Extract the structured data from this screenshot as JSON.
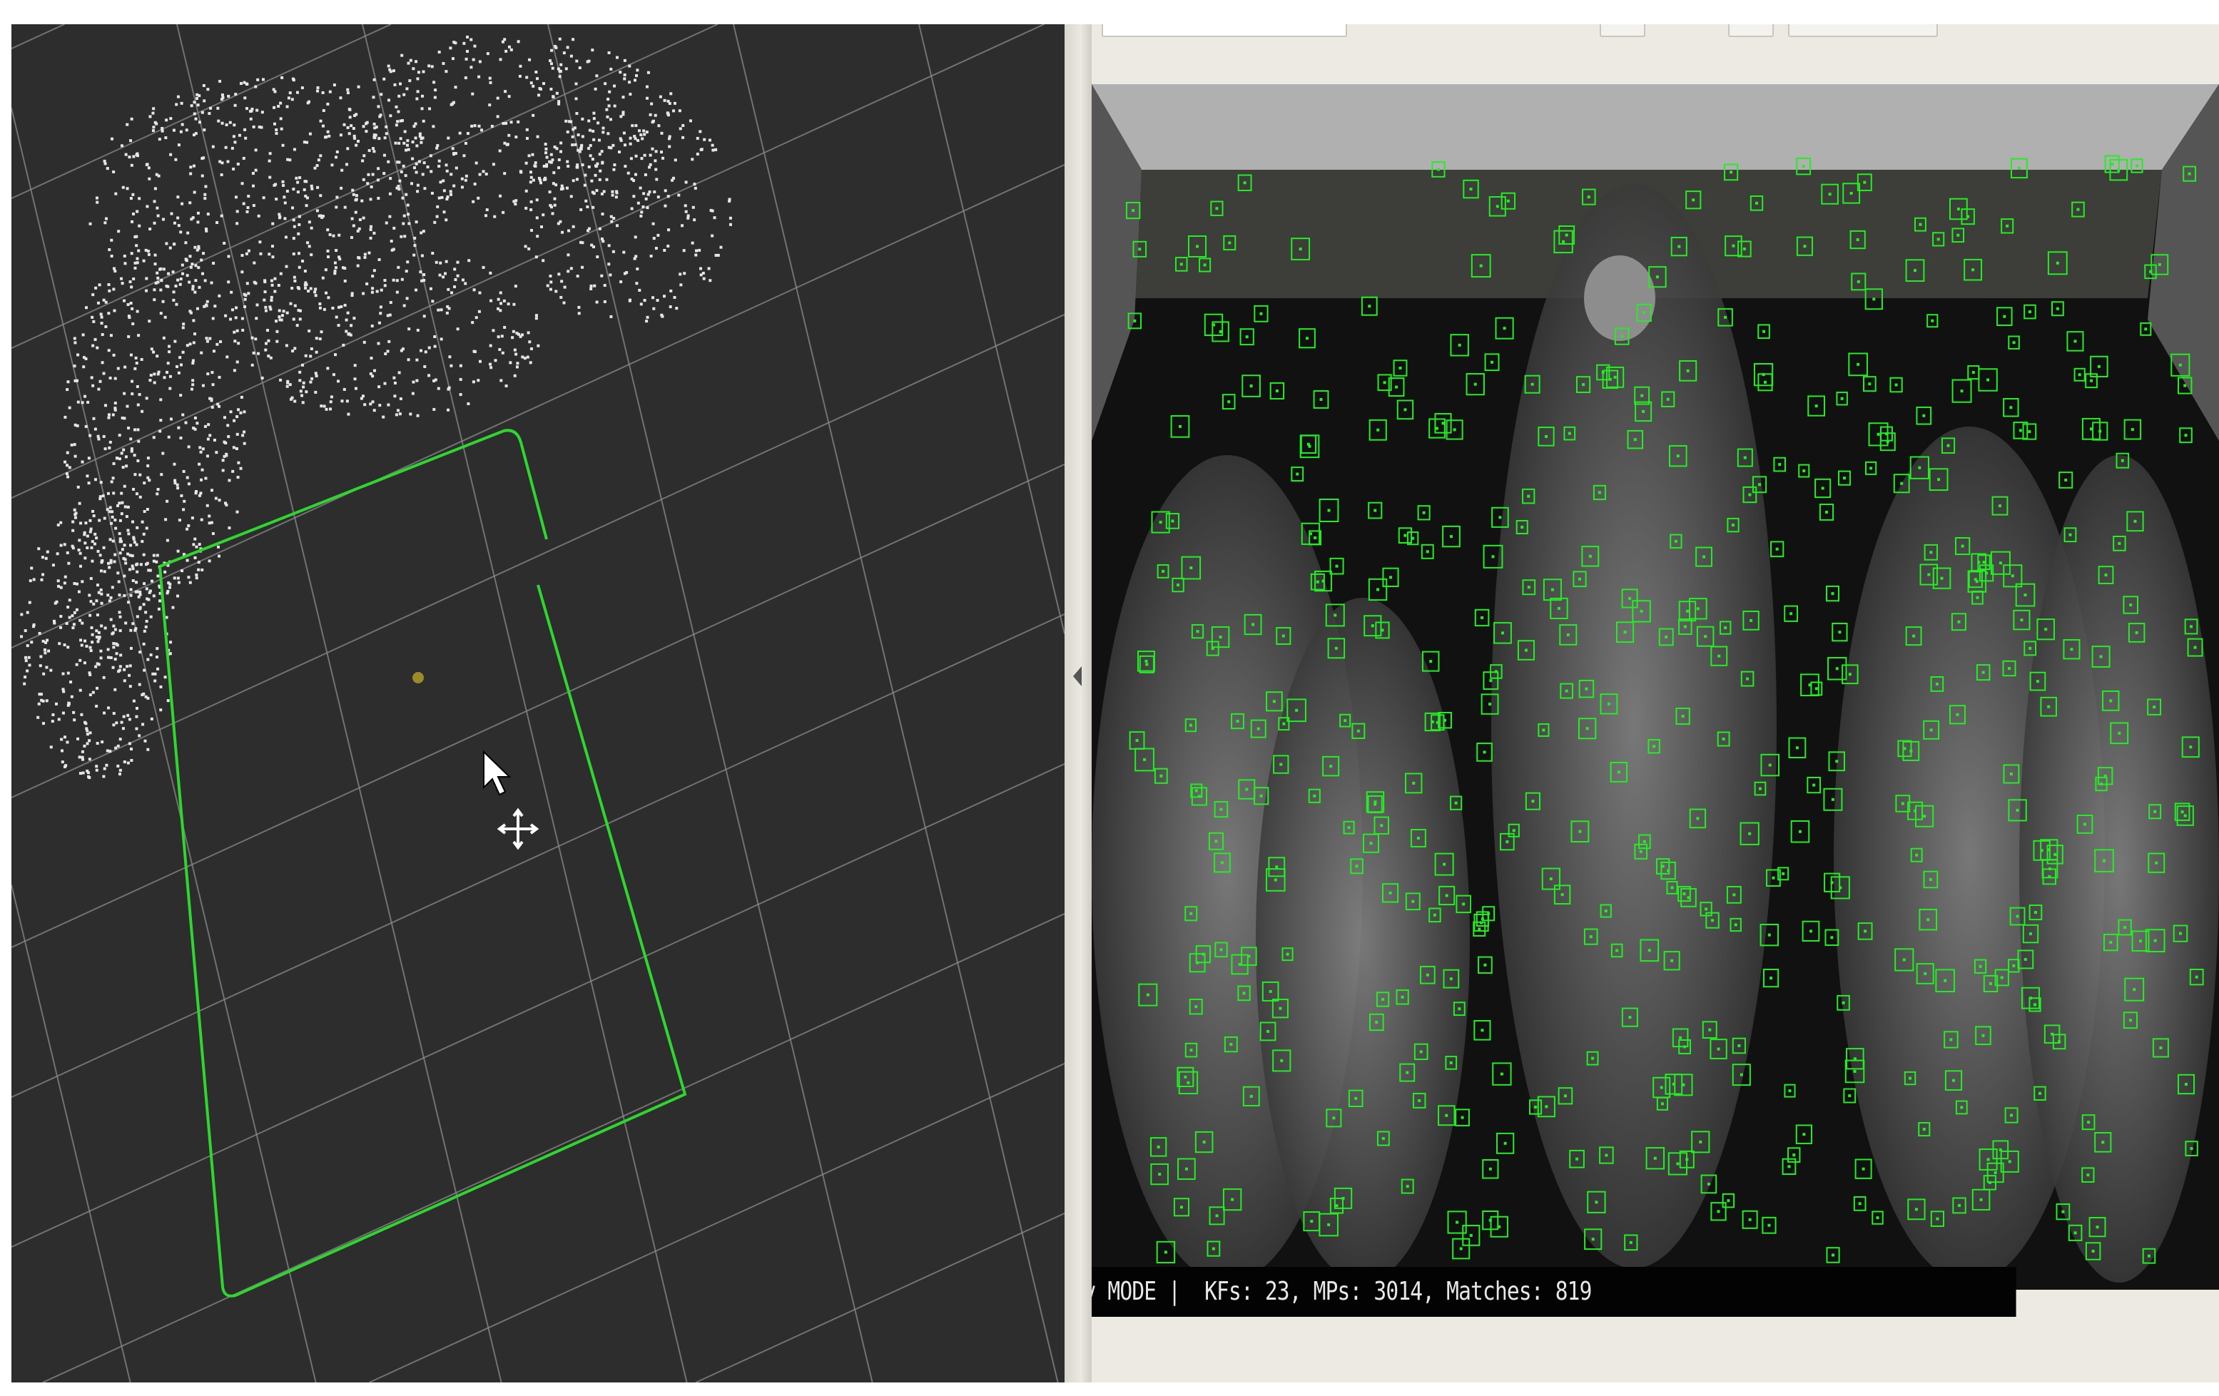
{
  "map_viewer": {
    "title": "ORB-SLAM Map Viewer",
    "colors": {
      "background": "#2d2d2d",
      "grid": "#8a8a8a",
      "map_points": "#e6e6e6",
      "camera": "#2fd62f",
      "current_point": "#9a8a2a"
    }
  },
  "frame_viewer": {
    "status": {
      "mode": "v MODE",
      "separator": "|",
      "stats": "KFs: 23, MPs: 3014, Matches: 819"
    },
    "colors": {
      "feature_box": "#22ee22",
      "status_bg": "#030303",
      "status_text": "#e8e8e8"
    }
  },
  "icons": [
    "cursor-arrow-icon",
    "move-cross-icon",
    "splitter-collapse-icon"
  ]
}
